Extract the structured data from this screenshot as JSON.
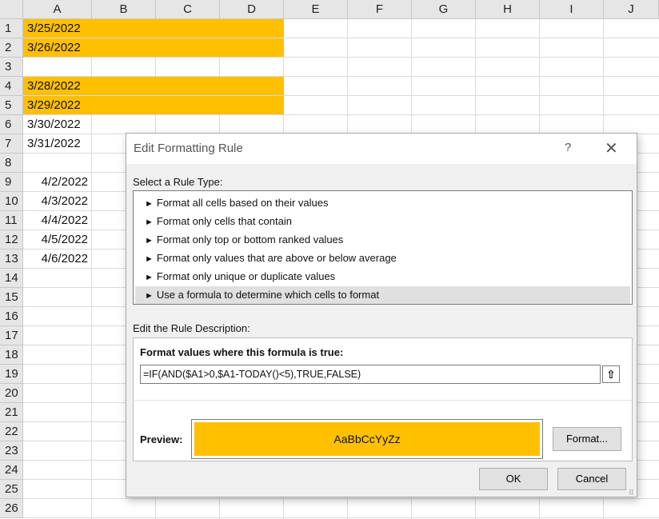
{
  "spreadsheet": {
    "columns": [
      "A",
      "B",
      "C",
      "D",
      "E",
      "F",
      "G",
      "H",
      "I",
      "J"
    ],
    "rows": [
      "1",
      "2",
      "3",
      "4",
      "5",
      "6",
      "7",
      "8",
      "9",
      "10",
      "11",
      "12",
      "13",
      "14",
      "15",
      "16",
      "17",
      "18",
      "19",
      "20",
      "21",
      "22",
      "23",
      "24",
      "25",
      "26"
    ],
    "cells_left": [
      "3/25/2022",
      "3/26/2022",
      "",
      "3/28/2022",
      "3/29/2022",
      "3/30/2022",
      "3/31/2022"
    ],
    "cells_right": [
      "",
      "",
      "",
      "",
      "",
      "",
      "",
      "",
      "4/2/2022",
      "4/3/2022",
      "4/4/2022",
      "4/5/2022",
      "4/6/2022"
    ],
    "highlight_color": "#ffc000"
  },
  "dialog": {
    "title": "Edit Formatting Rule",
    "help": "?",
    "close": "✕",
    "select_label": "Select a Rule Type:",
    "rule_types": [
      "Format all cells based on their values",
      "Format only cells that contain",
      "Format only top or bottom ranked values",
      "Format only values that are above or below average",
      "Format only unique or duplicate values",
      "Use a formula to determine which cells to format"
    ],
    "selected_rule_index": 5,
    "desc_label": "Edit the Rule Description:",
    "formula_label": "Format values where this formula is true:",
    "formula": "=IF(AND($A1>0,$A1-TODAY()<5),TRUE,FALSE)",
    "collapse_icon": "collapse-dialog-icon",
    "preview_label": "Preview:",
    "preview_text": "AaBbCcYyZz",
    "format_button": "Format...",
    "ok_button": "OK",
    "cancel_button": "Cancel"
  }
}
